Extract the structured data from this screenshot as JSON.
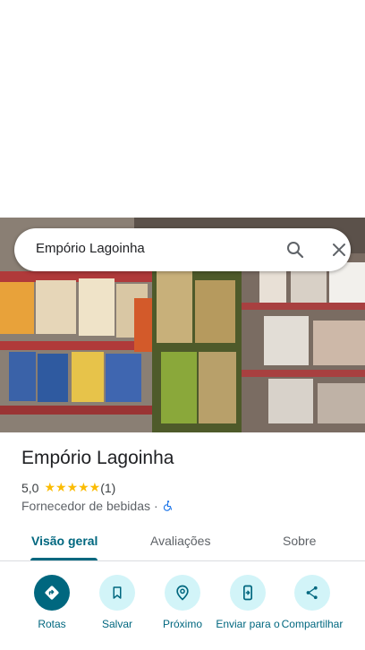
{
  "search": {
    "query": "Empório Lagoinha"
  },
  "place": {
    "name": "Empório Lagoinha",
    "rating": "5,0",
    "stars": "★★★★★",
    "review_count": "(1)",
    "category": "Fornecedor de bebidas",
    "separator": "·"
  },
  "tabs": [
    {
      "label": "Visão geral",
      "active": true
    },
    {
      "label": "Avaliações",
      "active": false
    },
    {
      "label": "Sobre",
      "active": false
    }
  ],
  "actions": [
    {
      "label": "Rotas",
      "icon": "directions-icon"
    },
    {
      "label": "Salvar",
      "icon": "bookmark-icon"
    },
    {
      "label": "Próximo",
      "icon": "nearby-icon"
    },
    {
      "label": "Enviar para o",
      "icon": "send-to-phone-icon"
    },
    {
      "label": "Compartilhar",
      "icon": "share-icon"
    }
  ],
  "colors": {
    "accent": "#00677f",
    "accent_light": "#d2f4f8",
    "star": "#fbbc04",
    "accessibility": "#1a73e8"
  }
}
